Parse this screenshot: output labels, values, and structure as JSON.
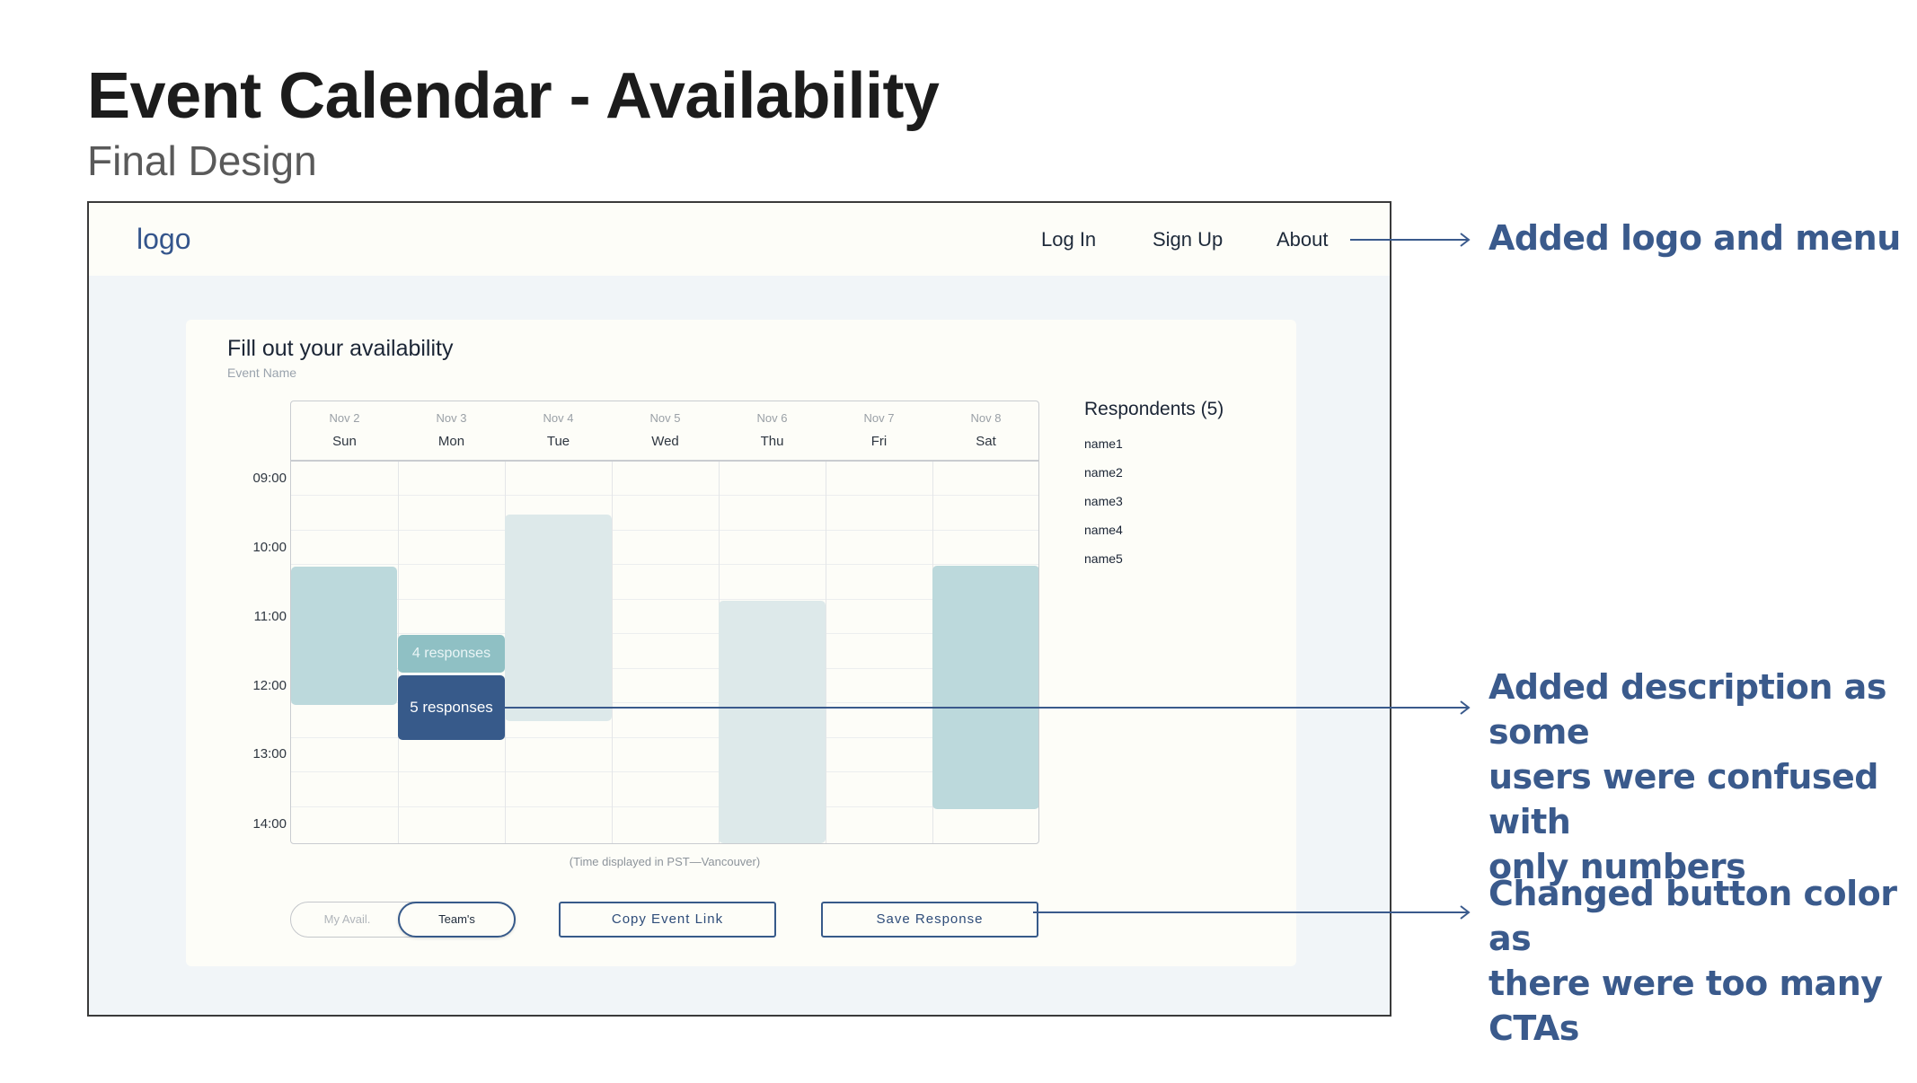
{
  "page": {
    "title": "Event Calendar - Availability",
    "subtitle": "Final Design"
  },
  "navbar": {
    "logo": "logo",
    "links": [
      "Log In",
      "Sign Up",
      "About"
    ]
  },
  "card": {
    "title": "Fill out your availability",
    "event_name": "Event Name"
  },
  "calendar": {
    "days": [
      {
        "date": "Nov 2",
        "name": "Sun"
      },
      {
        "date": "Nov 3",
        "name": "Mon"
      },
      {
        "date": "Nov 4",
        "name": "Tue"
      },
      {
        "date": "Nov 5",
        "name": "Wed"
      },
      {
        "date": "Nov 6",
        "name": "Thu"
      },
      {
        "date": "Nov 7",
        "name": "Fri"
      },
      {
        "date": "Nov 8",
        "name": "Sat"
      }
    ],
    "times": [
      "09:00",
      "10:00",
      "11:00",
      "12:00",
      "13:00",
      "14:00"
    ],
    "tooltip_responses_4": "4 responses",
    "tooltip_responses_5": "5 responses",
    "timezone_note": "(Time displayed in PST—Vancouver)"
  },
  "controls": {
    "toggle_mine": "My Avail.",
    "toggle_team": "Team's",
    "copy_link": "Copy Event Link",
    "save_response": "Save Response"
  },
  "respondents": {
    "title": "Respondents (5)",
    "names": [
      "name1",
      "name2",
      "name3",
      "name4",
      "name5"
    ]
  },
  "annotations": {
    "logo_menu": "Added logo and menu",
    "description_line1": "Added description as some",
    "description_line2": "users were confused with",
    "description_line3": "only numbers",
    "button_line1": "Changed button color as",
    "button_line2": "there were too many CTAs"
  },
  "colors": {
    "accent_navy": "#375a8a",
    "teal": "#8fc0c4",
    "light_teal": "#dde9ea",
    "annotation_blue": "#3a5a8c"
  }
}
